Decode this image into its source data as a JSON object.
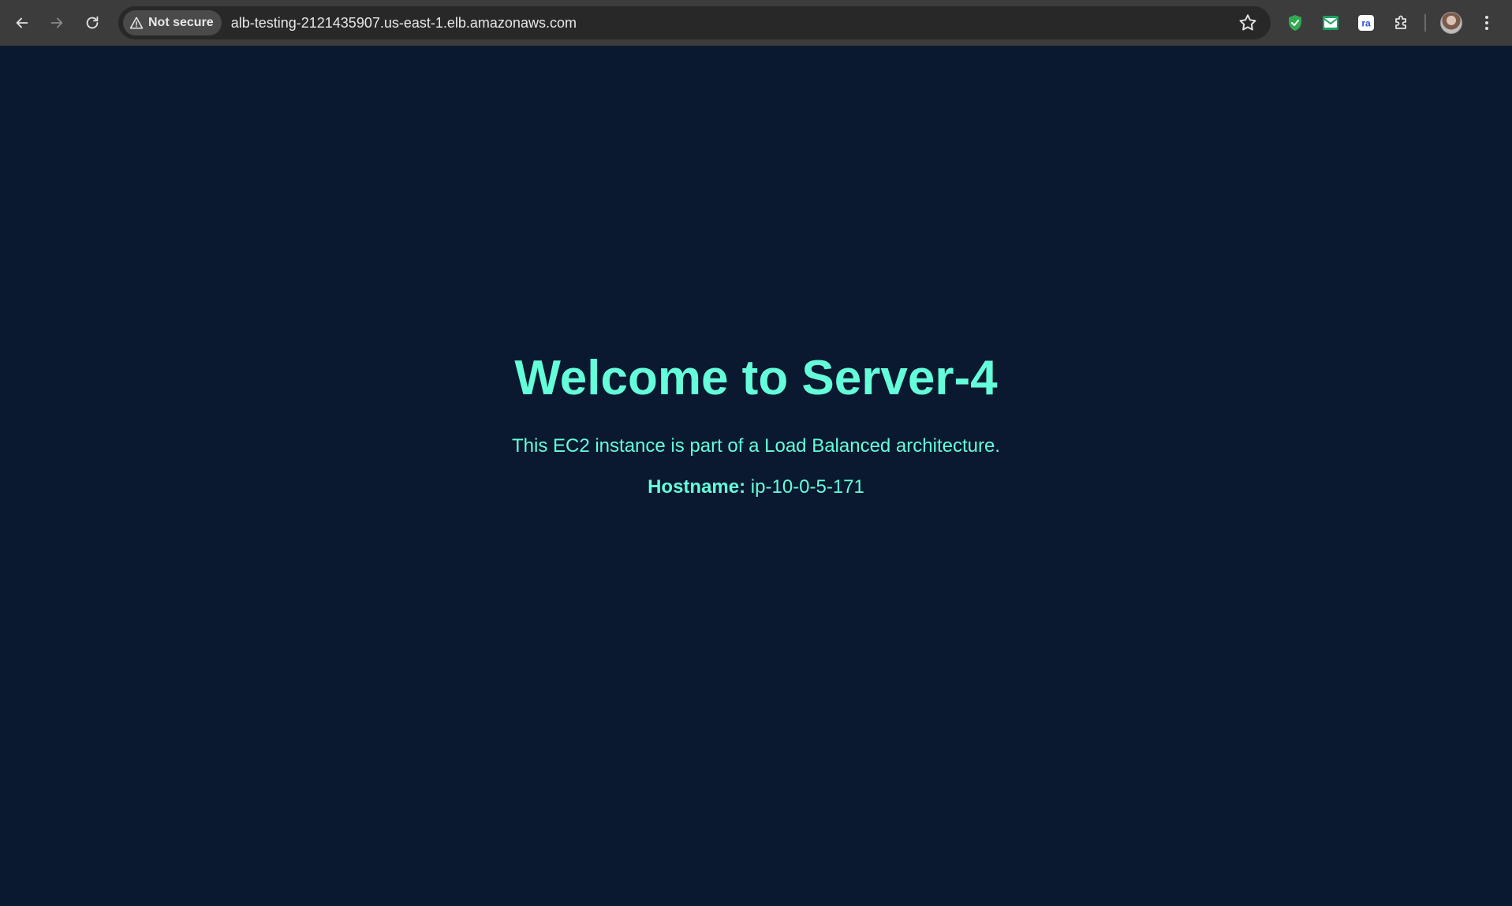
{
  "browser": {
    "security_label": "Not secure",
    "url": "alb-testing-2121435907.us-east-1.elb.amazonaws.com",
    "icons": {
      "back": "back-arrow-icon",
      "forward": "forward-arrow-icon",
      "reload": "reload-icon",
      "warning": "warning-triangle-icon",
      "bookmark": "star-icon",
      "extensions": [
        "shield-check-icon",
        "mail-icon",
        "ra-icon",
        "puzzle-icon"
      ],
      "menu": "kebab-menu-icon"
    },
    "extension_labels": {
      "ra": "ra"
    }
  },
  "page": {
    "title": "Welcome to Server-4",
    "subtitle": "This EC2 instance is part of a Load Balanced architecture.",
    "hostname_label": "Hostname:",
    "hostname_value": "ip-10-0-5-171"
  },
  "colors": {
    "background": "#0a1930",
    "accent": "#64ffda",
    "toolbar": "#3c3c3c",
    "omnibox": "#282828"
  }
}
